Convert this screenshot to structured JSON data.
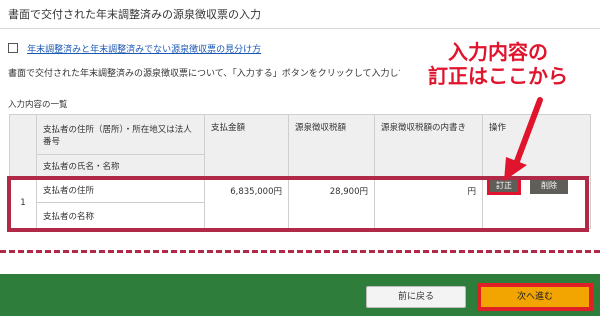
{
  "page": {
    "title": "書面で交付された年末調整済みの源泉徴収票の入力",
    "link_text": "年末調整済みと年末調整済みでない源泉徴収票の見分け方",
    "instruction": "書面で交付された年末調整済みの源泉徴収票について、「入力する」ボタンをクリックして入力してください。",
    "table_caption": "入力内容の一覧"
  },
  "table": {
    "headers": {
      "payer_address": "支払者の住所（居所）・所在地又は法人番号",
      "payer_name": "支払者の氏名・名称",
      "amount": "支払金額",
      "withholding": "源泉徴収税額",
      "withholding_detail": "源泉徴収税額の内書き",
      "operations": "操作"
    },
    "rows": [
      {
        "no": "1",
        "payer_address": "支払者の住所",
        "payer_name": "支払者の名称",
        "amount": "6,835,000円",
        "withholding": "28,900円",
        "withholding_detail": "円",
        "edit_label": "訂正",
        "delete_label": "削除"
      }
    ]
  },
  "footer": {
    "back_label": "前に戻る",
    "next_label": "次へ進む"
  },
  "annotation": {
    "line1": "入力内容の",
    "line2": "訂正はここから",
    "color": "#e0142d"
  },
  "colors": {
    "highlight_frame": "#b02a47",
    "footer_green": "#2e7d3a",
    "next_button": "#f2a400",
    "link": "#1a58b6"
  }
}
